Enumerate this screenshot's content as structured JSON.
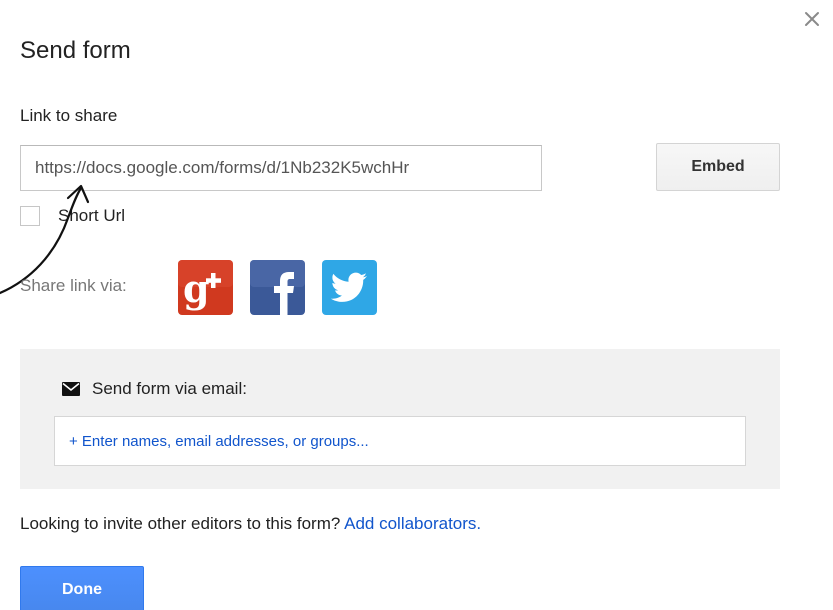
{
  "dialog": {
    "title": "Send form",
    "close_icon": "close-icon"
  },
  "link": {
    "label": "Link to share",
    "url_value": "https://docs.google.com/forms/d/1Nb232K5wchHr",
    "embed_label": "Embed"
  },
  "short_url": {
    "label": "Short Url",
    "checked": false
  },
  "share": {
    "label": "Share link via:",
    "networks": [
      {
        "name": "google-plus-icon",
        "glyph": "g+",
        "color": "#d0391f"
      },
      {
        "name": "facebook-icon",
        "glyph": "f",
        "color": "#3b5998"
      },
      {
        "name": "twitter-icon",
        "glyph": "bird",
        "color": "#2fa7e6"
      }
    ]
  },
  "email": {
    "heading": "Send form via email:",
    "icon": "envelope-icon",
    "placeholder": "+ Enter names, email addresses, or groups..."
  },
  "invite": {
    "text": "Looking to invite other editors to this form?",
    "link_label": "Add collaborators."
  },
  "done_label": "Done",
  "colors": {
    "accent_blue": "#4d90fe",
    "link_blue": "#1155cc",
    "panel_gray": "#f1f1f1"
  }
}
